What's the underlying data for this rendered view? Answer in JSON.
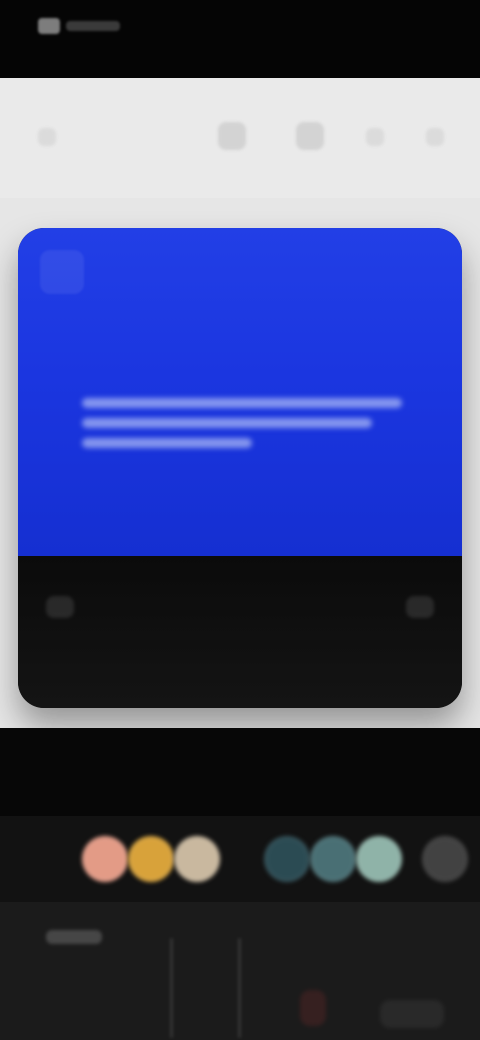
{
  "colors": {
    "topbar_bg": "#050505",
    "preview_bg": "#e6e6e6",
    "device_screen_blue": "#1b36e0",
    "device_bottom": "#0f0f0f",
    "bottom_panel_bg": "#1b1b1b"
  },
  "preview": {
    "headline": "",
    "subtext_lines": [
      "",
      "",
      ""
    ]
  },
  "swatches": [
    {
      "name": "skin-peach",
      "color": "#e39b86"
    },
    {
      "name": "gold",
      "color": "#d8a23a"
    },
    {
      "name": "beige",
      "color": "#c9b89f"
    },
    {
      "name": "teal-dark",
      "color": "#2b4b53"
    },
    {
      "name": "teal",
      "color": "#496f74"
    },
    {
      "name": "mint",
      "color": "#8fb3a8"
    },
    {
      "name": "gray",
      "color": "#6a6a6a"
    }
  ]
}
